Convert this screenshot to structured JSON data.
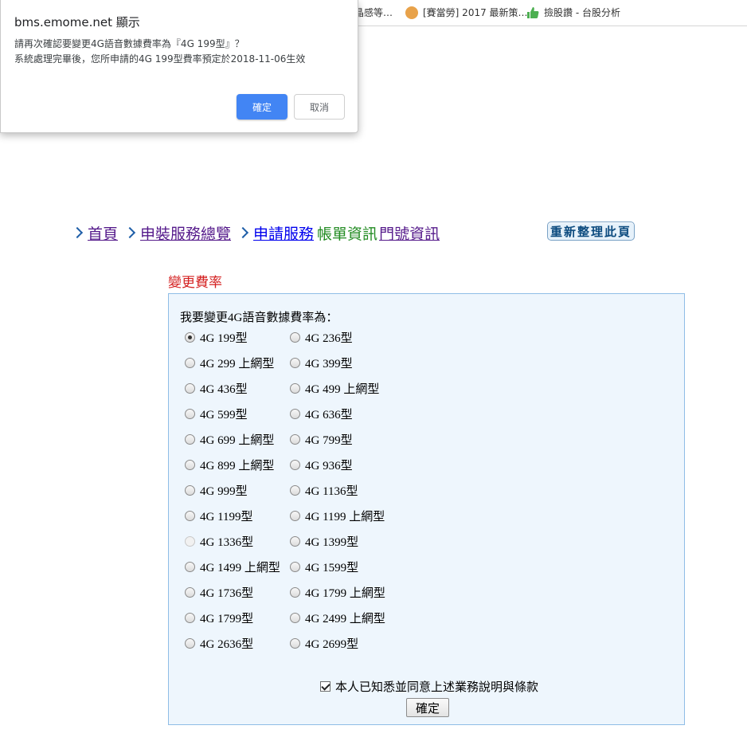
{
  "bookmarks": [
    {
      "label": "晶感等…",
      "icon": "bookmark-icon"
    },
    {
      "label": "[賽當勞] 2017 最新策…",
      "icon": "cat-face-icon"
    },
    {
      "label": "撿股讚 - 台股分析",
      "icon": "thumbs-up-icon"
    }
  ],
  "dialog": {
    "title": "bms.emome.net 顯示",
    "line1": "請再次確認要變更4G語音數據費率為『4G 199型』？",
    "line2": "系統處理完畢後，您所申請的4G 199型費率預定於2018-11-06生效",
    "ok_label": "確定",
    "cancel_label": "取消"
  },
  "nav": {
    "home": "首頁",
    "overview": "申裝服務總覽",
    "apply": "申請服務",
    "billing": "帳單資訊",
    "store": "門號資訊",
    "refresh": "重新整理此頁"
  },
  "section_title": "變更費率",
  "form": {
    "prompt": "我要變更4G語音數據費率為：",
    "options": [
      {
        "label": "4G 199型",
        "checked": true
      },
      {
        "label": "4G 236型"
      },
      {
        "label": "4G 299 上網型"
      },
      {
        "label": "4G 399型"
      },
      {
        "label": "4G 436型"
      },
      {
        "label": "4G 499 上網型"
      },
      {
        "label": "4G 599型"
      },
      {
        "label": "4G 636型"
      },
      {
        "label": "4G 699 上網型"
      },
      {
        "label": "4G 799型"
      },
      {
        "label": "4G 899 上網型"
      },
      {
        "label": "4G 936型"
      },
      {
        "label": "4G 999型"
      },
      {
        "label": "4G 1136型"
      },
      {
        "label": "4G 1199型"
      },
      {
        "label": "4G 1199 上網型"
      },
      {
        "label": "4G 1336型",
        "disabled": true
      },
      {
        "label": "4G 1399型"
      },
      {
        "label": "4G 1499 上網型"
      },
      {
        "label": "4G 1599型"
      },
      {
        "label": "4G 1736型"
      },
      {
        "label": "4G 1799 上網型"
      },
      {
        "label": "4G 1799型"
      },
      {
        "label": "4G 2499 上網型"
      },
      {
        "label": "4G 2636型"
      },
      {
        "label": "4G 2699型"
      }
    ],
    "agree_label": "本人已知悉並同意上述業務說明與條款",
    "agree_checked": true,
    "submit_label": "確定"
  },
  "colors": {
    "dialog_ok": "#4285f4",
    "section_title": "#d42020",
    "panel_bg": "#eef6fd",
    "panel_border": "#8fbde6",
    "nav_green": "#228b22"
  }
}
